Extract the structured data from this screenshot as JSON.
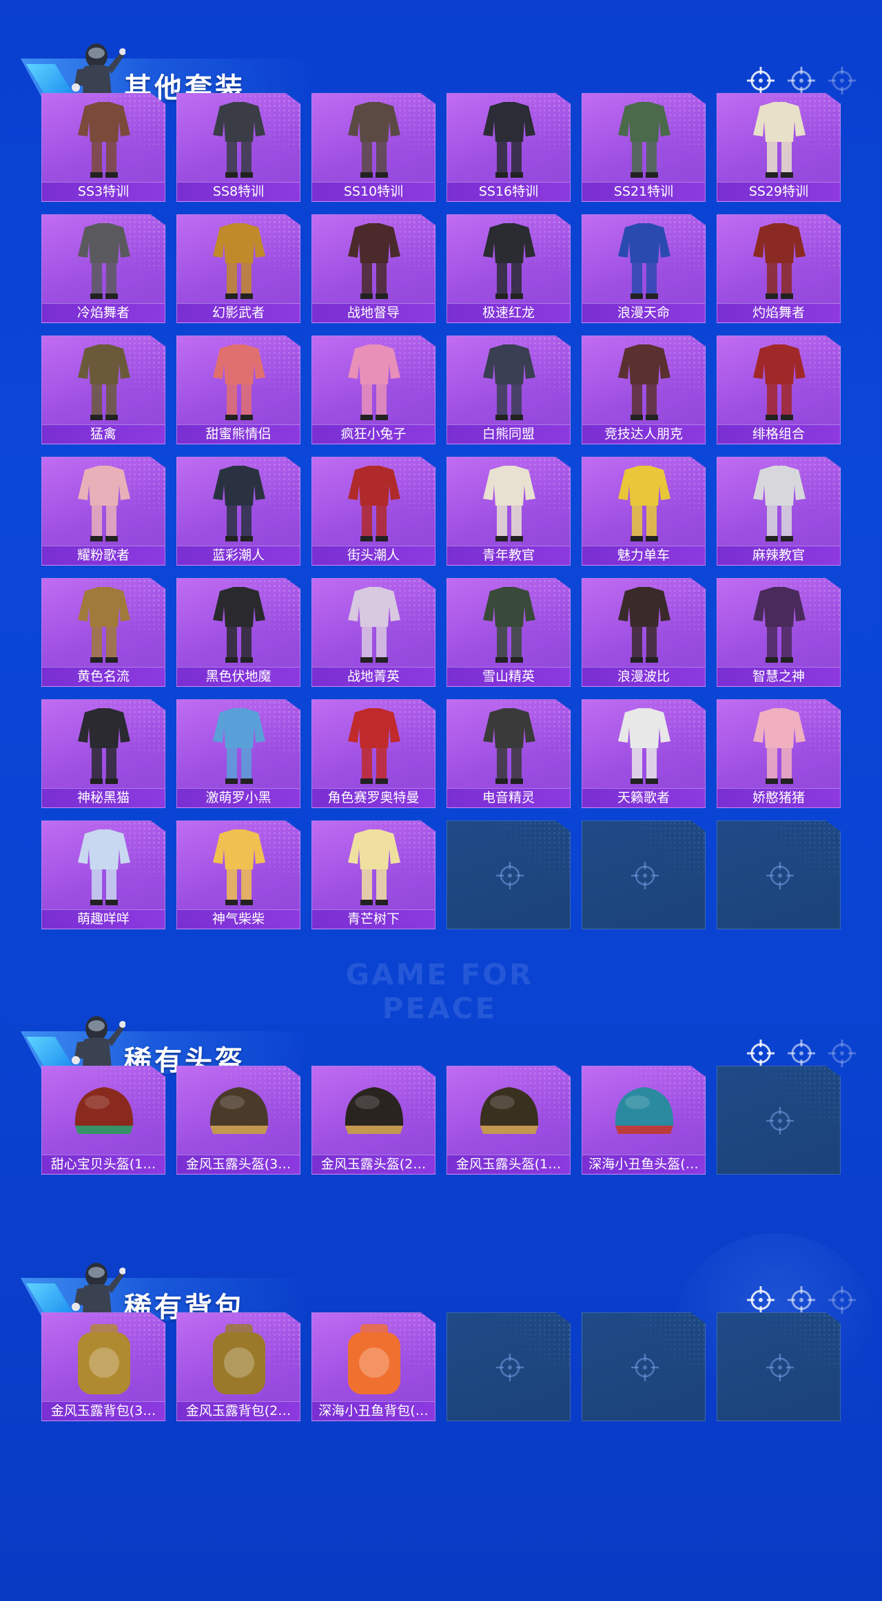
{
  "sections": [
    {
      "title": "其他套装",
      "items": [
        "SS3特训",
        "SS8特训",
        "SS10特训",
        "SS16特训",
        "SS21特训",
        "SS29特训",
        "冷焰舞者",
        "幻影武者",
        "战地督导",
        "极速红龙",
        "浪漫天命",
        "灼焰舞者",
        "猛禽",
        "甜蜜熊情侣",
        "疯狂小兔子",
        "白熊同盟",
        "竞技达人朋克",
        "绯格组合",
        "耀粉歌者",
        "蓝彩潮人",
        "街头潮人",
        "青年教官",
        "魅力单车",
        "麻辣教官",
        "黄色名流",
        "黑色伏地魔",
        "战地菁英",
        "雪山精英",
        "浪漫波比",
        "智慧之神",
        "神秘黑猫",
        "激萌罗小黑",
        "角色赛罗奥特曼",
        "电音精灵",
        "天籁歌者",
        "娇憨猪猪",
        "萌趣咩咩",
        "神气柴柴",
        "青芒树下"
      ],
      "empty_slots": 3
    },
    {
      "title": "稀有头盔",
      "items": [
        "甜心宝贝头盔(1…",
        "金风玉露头盔(3…",
        "金风玉露头盔(2…",
        "金风玉露头盔(1…",
        "深海小丑鱼头盔(…"
      ],
      "empty_slots": 1
    },
    {
      "title": "稀有背包",
      "items": [
        "金风玉露背包(3…",
        "金风玉露背包(2…",
        "深海小丑鱼背包(…"
      ],
      "empty_slots": 3
    }
  ],
  "watermark": "GAME FOR PEACE",
  "colors": {
    "background": "#0a43d2",
    "card": "#a255e6",
    "label_bar": "#7a2fd3",
    "empty_card": "#1f4a86"
  },
  "icons": [
    "crosshair-icon",
    "character-avatar-icon"
  ]
}
